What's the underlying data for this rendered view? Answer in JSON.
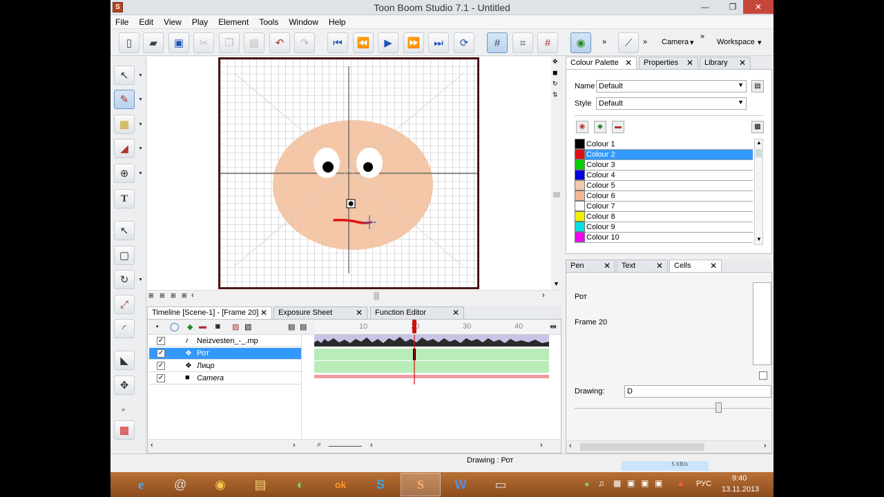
{
  "window": {
    "title": "Toon Boom Studio 7.1 - Untitled",
    "app_icon": "S"
  },
  "winbuttons": {
    "minimize": "—",
    "maximize": "❐",
    "close": "✕"
  },
  "menu": [
    "File",
    "Edit",
    "View",
    "Play",
    "Element",
    "Tools",
    "Window",
    "Help"
  ],
  "toolbar": {
    "camera_label": "Camera",
    "workspace_label": "Workspace",
    "more": "»",
    "dropdown": "▾"
  },
  "canvas": {
    "face_color": "#f2c2a0",
    "mouth_color": "#e01010",
    "frame_color": "#4a1515"
  },
  "colour_panel": {
    "tabs": [
      {
        "label": "Colour Palette",
        "close": "✕"
      },
      {
        "label": "Properties",
        "close": "✕"
      },
      {
        "label": "Library",
        "close": "✕"
      }
    ],
    "name_label": "Name",
    "name_value": "Default",
    "style_label": "Style",
    "style_value": "Default",
    "colours": [
      {
        "name": "Colour 1",
        "color": "#000000"
      },
      {
        "name": "Colour 2",
        "color": "#e01010"
      },
      {
        "name": "Colour 3",
        "color": "#00d000"
      },
      {
        "name": "Colour 4",
        "color": "#0000e0"
      },
      {
        "name": "Colour 5",
        "color": "#f2c8b0"
      },
      {
        "name": "Colour 6",
        "color": "#f0b896"
      },
      {
        "name": "Colour 7",
        "color": "#ffffff"
      },
      {
        "name": "Colour 8",
        "color": "#f0f000"
      },
      {
        "name": "Colour 9",
        "color": "#00e0e0"
      },
      {
        "name": "Colour 10",
        "color": "#f000f0"
      }
    ],
    "selected_index": 1
  },
  "cells_panel": {
    "tabs": [
      {
        "label": "Pen",
        "close": "✕"
      },
      {
        "label": "Text",
        "close": "✕"
      },
      {
        "label": "Cells",
        "close": "✕"
      }
    ],
    "element_name": "Рот",
    "frame_label": "Frame 20",
    "drawing_label": "Drawing:",
    "drawing_value": "D"
  },
  "timeline": {
    "tabs": [
      {
        "label": "Timeline [Scene-1] - [Frame 20]",
        "close": "✕"
      },
      {
        "label": "Exposure Sheet",
        "close": "✕"
      },
      {
        "label": "Function Editor",
        "close": "✕"
      }
    ],
    "ruler": [
      "10",
      "20",
      "30",
      "40"
    ],
    "current_frame": 20,
    "layers": [
      {
        "name": "Neizvesten_-_.mp",
        "icon": "♪",
        "checked": "✓"
      },
      {
        "name": "Рот",
        "icon": "❖",
        "checked": "✓"
      },
      {
        "name": "Лицо",
        "icon": "❖",
        "checked": "✓"
      },
      {
        "name": "Camera",
        "icon": "■",
        "checked": "✓"
      }
    ],
    "selected_layer": 1
  },
  "status": {
    "text": "Drawing : Рот"
  },
  "taskbar": {
    "apps": [
      "e",
      "@",
      "◉",
      "▤",
      "◐",
      "ok",
      "S",
      "S",
      "W",
      "▭"
    ],
    "lang": "РУС",
    "time": "9:40",
    "date": "13.11.2013",
    "net_speed": "5 KB/s"
  }
}
